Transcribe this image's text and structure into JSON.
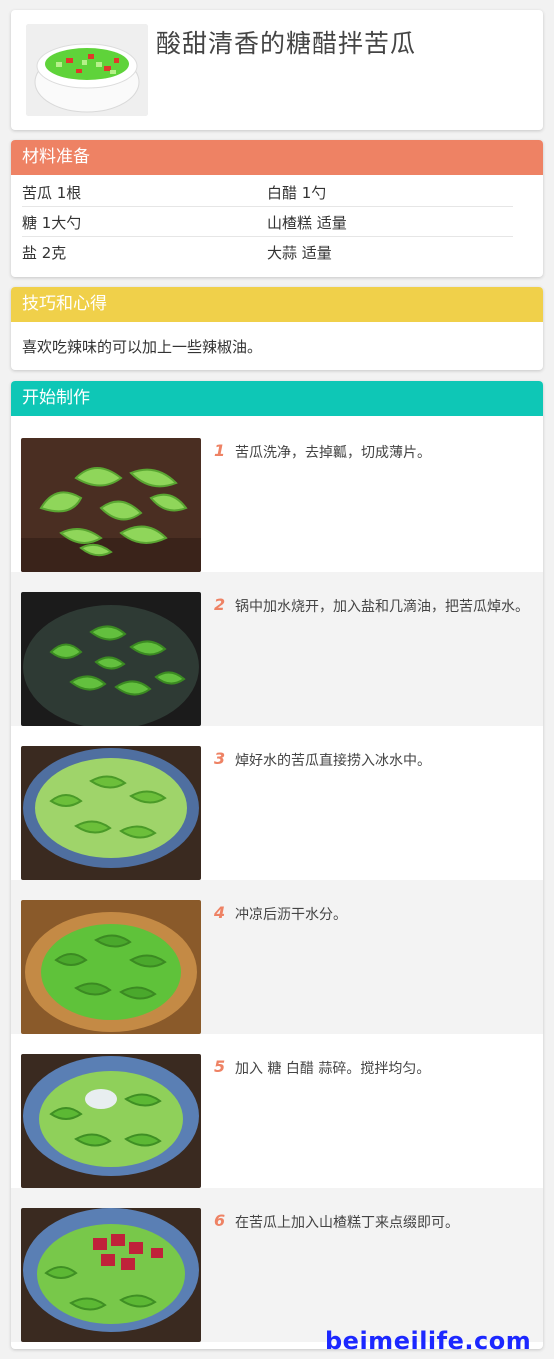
{
  "recipe": {
    "title": "酸甜清香的糖醋拌苦瓜"
  },
  "ingredients": {
    "heading": "材料准备",
    "rows": [
      {
        "left": "苦瓜  1根",
        "right": "白醋  1勺"
      },
      {
        "left": "糖  1大勺",
        "right": "山楂糕  适量"
      },
      {
        "left": "盐  2克",
        "right": "大蒜  适量"
      }
    ]
  },
  "tips": {
    "heading": "技巧和心得",
    "text": "喜欢吃辣味的可以加上一些辣椒油。"
  },
  "steps": {
    "heading": "开始制作",
    "items": [
      {
        "num": "1",
        "text": "苦瓜洗净，去掉瓤，切成薄片。"
      },
      {
        "num": "2",
        "text": "锅中加水烧开，加入盐和几滴油，把苦瓜焯水。"
      },
      {
        "num": "3",
        "text": "焯好水的苦瓜直接捞入冰水中。"
      },
      {
        "num": "4",
        "text": "冲凉后沥干水分。"
      },
      {
        "num": "5",
        "text": "加入 糖 白醋 蒜碎。搅拌均匀。"
      },
      {
        "num": "6",
        "text": "在苦瓜上加入山楂糕丁来点缀即可。"
      }
    ]
  },
  "watermark": "beimeilife.com",
  "colors": {
    "accent_orange": "#ee8264",
    "accent_yellow": "#f0d04a",
    "accent_teal": "#0ec7b6"
  }
}
